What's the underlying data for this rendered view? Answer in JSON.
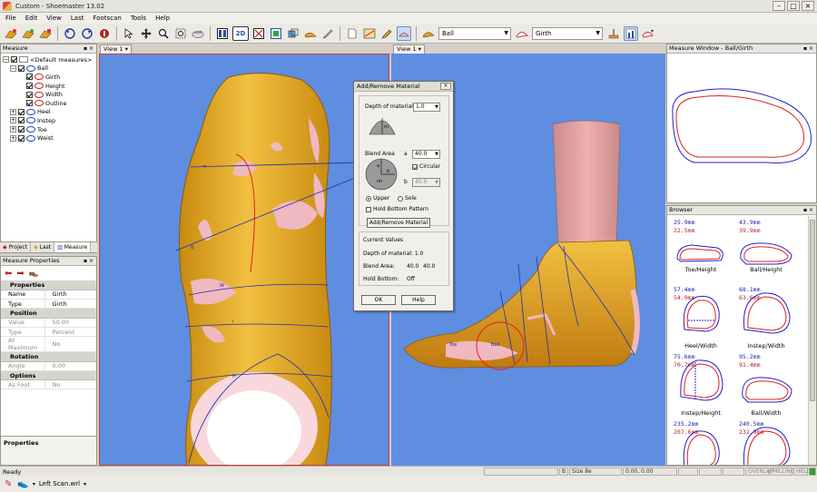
{
  "window": {
    "title": "Custom - Shoemaster 13.02"
  },
  "menu": [
    "File",
    "Edit",
    "View",
    "Last",
    "Footscan",
    "Tools",
    "Help"
  ],
  "toolbar": {
    "measure_combo": "Ball",
    "style_combo": "Girth",
    "view_mode": "2D"
  },
  "measure_panel": {
    "title": "Measure",
    "root": "<Default measures>",
    "items": [
      {
        "label": "Ball",
        "expanded": true,
        "children": [
          "Girth",
          "Height",
          "Width",
          "Outline"
        ]
      },
      {
        "label": "Heel"
      },
      {
        "label": "Instep"
      },
      {
        "label": "Toe"
      },
      {
        "label": "Waist"
      }
    ],
    "tabs": [
      "Project",
      "Last",
      "Measure"
    ]
  },
  "properties_panel": {
    "title": "Measure Properties",
    "groups": [
      {
        "name": "Properties",
        "rows": [
          [
            "Name",
            "Girth",
            false
          ],
          [
            "Type",
            "Girth",
            false
          ]
        ]
      },
      {
        "name": "Position",
        "rows": [
          [
            "Value",
            "50.00",
            true
          ],
          [
            "Type",
            "Percent",
            true
          ],
          [
            "At Maximum",
            "No",
            true
          ]
        ]
      },
      {
        "name": "Rotation",
        "rows": [
          [
            "Angle",
            "0.00",
            true
          ]
        ]
      },
      {
        "name": "Options",
        "rows": [
          [
            "As Foot",
            "No",
            true
          ]
        ]
      }
    ],
    "footer": "Properties"
  },
  "views": {
    "left": "View 1",
    "right": "View 1"
  },
  "dialog": {
    "title": "Add/Remove Material",
    "depth_label": "Depth of material",
    "depth_value": "1.0",
    "blend_label": "Blend Area",
    "a_label": "a",
    "a_value": "40.0",
    "circular_label": "Circular",
    "b_label": "b",
    "b_value": "40.0",
    "upper_label": "Upper",
    "sole_label": "Sole",
    "hold_label": "Hold Bottom Pattern",
    "apply_button": "Add/Remove Material",
    "current_title": "Current Values",
    "current_depth": "Depth of material: 1.0",
    "current_blend_label": "Blend Area:",
    "current_blend_a": "40.0",
    "current_blend_b": "40.0",
    "current_hold_label": "Hold Bottom:",
    "current_hold_value": "Off",
    "ok_button": "OK",
    "help_button": "Help",
    "diagram_labels": {
      "depth_symbol": "m",
      "a": "a",
      "b": "b",
      "center": "nn"
    }
  },
  "measure_window": {
    "title": "Measure Window - Ball/Girth"
  },
  "browser": {
    "title": "Browser",
    "cells": [
      {
        "v1": "25.9mm",
        "v2": "22.5mm",
        "label": "Toe/Height"
      },
      {
        "v1": "43.9mm",
        "v2": "39.9mm",
        "label": "Ball/Height"
      },
      {
        "v1": "57.4mm",
        "v2": "54.9mm",
        "label": "Heel/Width"
      },
      {
        "v1": "68.1mm",
        "v2": "63.6mm",
        "label": "Instep/Width"
      },
      {
        "v1": "75.6mm",
        "v2": "70.7mm",
        "label": "Instep/Height"
      },
      {
        "v1": "95.2mm",
        "v2": "91.4mm",
        "label": "Ball/Width"
      },
      {
        "v1": "235.2mm",
        "v2": "207.6mm",
        "label": ""
      },
      {
        "v1": "240.5mm",
        "v2": "232.9mm",
        "label": ""
      }
    ]
  },
  "status": {
    "left": "Ready",
    "cell_b": "B",
    "size": "Size 8e",
    "coords": "0.00, 0.00",
    "modes": [
      "OVERLAP",
      "MILLING",
      "HELD"
    ]
  },
  "bottom": {
    "file": "Left Scan.wrl"
  },
  "colors": {
    "viewport_bg": "#5f8de0",
    "foot_gold": "#e0a020",
    "blend_pink": "#f0b8c0",
    "outline_blue": "#2020d0",
    "outline_red": "#e02020"
  }
}
